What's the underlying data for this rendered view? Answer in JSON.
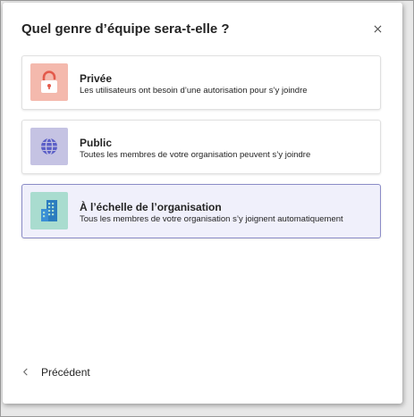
{
  "dialog": {
    "title": "Quel genre d’équipe sera-t-elle ?",
    "close_icon": "close-icon"
  },
  "options": [
    {
      "title": "Privée",
      "description": "Les utilisateurs ont besoin d’une autorisation pour s’y joindre",
      "icon": "lock-icon",
      "icon_bg": "#f4b9ad",
      "icon_color": "#d13438",
      "selected": false
    },
    {
      "title": "Public",
      "description": "Toutes les membres de votre organisation peuvent s’y joindre",
      "icon": "globe-icon",
      "icon_bg": "#c5c3e3",
      "icon_color": "#5b5fc7",
      "selected": false
    },
    {
      "title": "À l’échelle de l’organisation",
      "description": "Tous les membres de votre organisation s’y joignent automatiquement",
      "icon": "building-icon",
      "icon_bg": "#a9dccf",
      "icon_color": "#2b7cbf",
      "selected": true
    }
  ],
  "footer": {
    "back_label": "Précédent",
    "back_icon": "chevron-left-icon"
  }
}
